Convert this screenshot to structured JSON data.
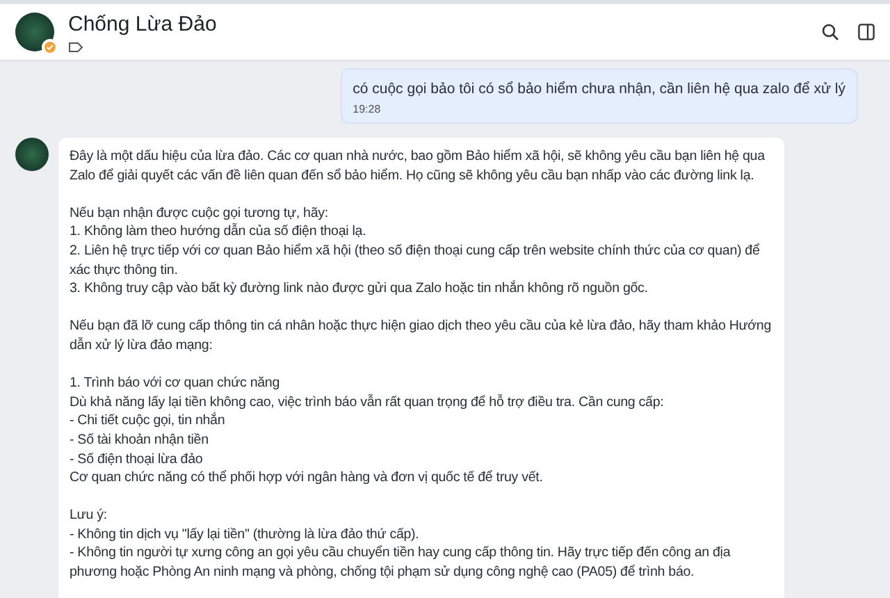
{
  "header": {
    "title": "Chống Lừa Đảo",
    "verified": true
  },
  "messages": [
    {
      "kind": "user",
      "text": "có cuộc gọi bảo tôi có sổ bảo hiểm chưa nhận, cần liên hệ qua zalo để xử lý",
      "time": "19:28"
    },
    {
      "kind": "bot",
      "blocks": [
        [
          "Đây là một dấu hiệu của lừa đảo. Các cơ quan nhà nước, bao gồm Bảo hiểm xã hội, sẽ không yêu cầu bạn liên hệ qua Zalo để giải quyết các vấn đề liên quan đến sổ bảo hiểm. Họ cũng sẽ không yêu cầu bạn nhấp vào các đường link lạ."
        ],
        [
          "Nếu bạn nhận được cuộc gọi tương tự, hãy:",
          "1. Không làm theo hướng dẫn của số điện thoại lạ.",
          "2. Liên hệ trực tiếp với cơ quan Bảo hiểm xã hội (theo số điện thoại cung cấp trên website chính thức của cơ quan) để xác thực thông tin.",
          "3. Không truy cập vào bất kỳ đường link nào được gửi qua Zalo hoặc tin nhắn không rõ nguồn gốc."
        ],
        [
          "Nếu bạn đã lỡ cung cấp thông tin cá nhân hoặc thực hiện giao dịch theo yêu cầu của kẻ lừa đảo, hãy tham khảo Hướng dẫn xử lý lừa đảo mạng:"
        ],
        [
          "1. Trình báo với cơ quan chức năng",
          "Dù khả năng lấy lại tiền không cao, việc trình báo vẫn rất quan trọng để hỗ trợ điều tra. Cần cung cấp:",
          "- Chi tiết cuộc gọi, tin nhắn",
          "- Số tài khoản nhận tiền",
          "- Số điện thoại lừa đảo",
          "Cơ quan chức năng có thể phối hợp với ngân hàng và đơn vị quốc tế để truy vết."
        ],
        [
          "Lưu ý:",
          "- Không tin dịch vụ \"lấy lại tiền\" (thường là lừa đảo thứ cấp).",
          "- Không tin người tự xưng công an gọi yêu cầu chuyển tiền hay cung cấp thông tin. Hãy trực tiếp đến công an địa phương hoặc Phòng An ninh mạng và phòng, chống tội phạm sử dụng công nghệ cao (PA05) để trình báo."
        ]
      ]
    }
  ]
}
